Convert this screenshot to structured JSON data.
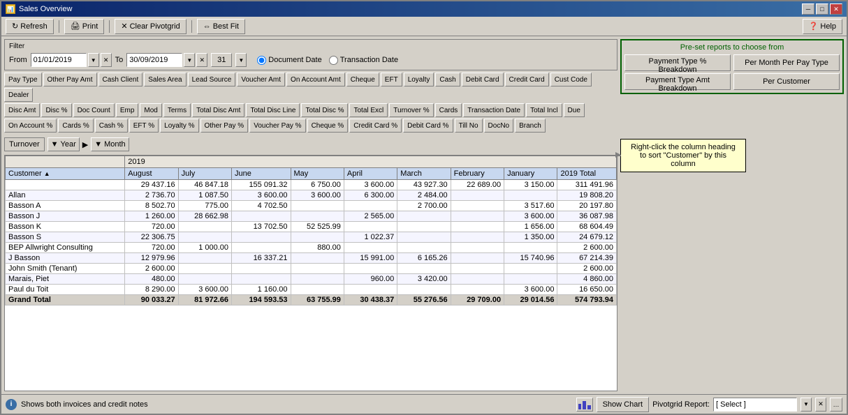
{
  "window": {
    "title": "Sales Overview"
  },
  "toolbar": {
    "refresh": "Refresh",
    "print": "Print",
    "clear_pivotgrid": "Clear Pivotgrid",
    "best_fit": "Best Fit",
    "help": "Help"
  },
  "filter": {
    "label": "Filter",
    "from_label": "From",
    "to_label": "To",
    "from_date": "01/01/2019",
    "to_date": "30/09/2019",
    "num": "31",
    "document_date": "Document Date",
    "transaction_date": "Transaction Date"
  },
  "preset": {
    "label": "Pre-set reports to choose from",
    "buttons": [
      [
        "Payment Type % Breakdown",
        "Per Month Per Pay Type"
      ],
      [
        "Payment Type Amt Breakdown",
        "Per Customer"
      ]
    ]
  },
  "field_rows": {
    "row1": [
      "Pay Type",
      "Other Pay Amt",
      "Cash Client",
      "Sales Area",
      "Lead Source",
      "Voucher Amt",
      "On Account Amt",
      "Cheque",
      "EFT",
      "Loyalty",
      "Cash",
      "Debit Card",
      "Credit Card",
      "Cust Code",
      "Dealer"
    ],
    "row2": [
      "Disc Amt",
      "Disc %",
      "Doc Count",
      "Emp",
      "Mod",
      "Terms",
      "Total Disc Amt",
      "Total Disc Line",
      "Total Disc %",
      "Total Excl",
      "Turnover %",
      "Cards",
      "Transaction Date",
      "Total Incl",
      "Due"
    ],
    "row3": [
      "On Account %",
      "Cards %",
      "Cash %",
      "EFT %",
      "Loyalty %",
      "Other Pay %",
      "Voucher Pay %",
      "Cheque %",
      "Credit Card %",
      "Debit Card %",
      "Till No",
      "DocNo",
      "Branch"
    ]
  },
  "pivot": {
    "row_label": "Turnover",
    "col1_label": "Year",
    "col2_label": "Month"
  },
  "table": {
    "year": "2019",
    "customer_header": "Customer",
    "columns": [
      "August",
      "July",
      "June",
      "May",
      "April",
      "March",
      "February",
      "January",
      "2019 Total"
    ],
    "rows": [
      {
        "customer": "",
        "august": "29 437.16",
        "july": "46 847.18",
        "june": "155 091.32",
        "may": "6 750.00",
        "april": "3 600.00",
        "march": "43 927.30",
        "february": "22 689.00",
        "january": "3 150.00",
        "total": "311 491.96"
      },
      {
        "customer": "Allan",
        "august": "2 736.70",
        "july": "1 087.50",
        "june": "3 600.00",
        "may": "3 600.00",
        "april": "6 300.00",
        "march": "2 484.00",
        "february": "",
        "january": "",
        "total": "19 808.20"
      },
      {
        "customer": "Basson A",
        "august": "8 502.70",
        "july": "775.00",
        "june": "4 702.50",
        "may": "",
        "april": "",
        "march": "2 700.00",
        "february": "",
        "january": "3 517.60",
        "total": "20 197.80"
      },
      {
        "customer": "Basson J",
        "august": "1 260.00",
        "july": "28 662.98",
        "june": "",
        "may": "",
        "april": "2 565.00",
        "march": "",
        "february": "",
        "january": "3 600.00",
        "total": "36 087.98"
      },
      {
        "customer": "Basson K",
        "august": "720.00",
        "july": "",
        "june": "13 702.50",
        "may": "52 525.99",
        "april": "",
        "march": "",
        "february": "",
        "january": "1 656.00",
        "total": "68 604.49"
      },
      {
        "customer": "Basson S",
        "august": "22 306.75",
        "july": "",
        "june": "",
        "may": "",
        "april": "1 022.37",
        "march": "",
        "february": "",
        "january": "1 350.00",
        "total": "24 679.12"
      },
      {
        "customer": "BEP Allwright Consulting",
        "august": "720.00",
        "july": "1 000.00",
        "june": "",
        "may": "880.00",
        "april": "",
        "march": "",
        "february": "",
        "january": "",
        "total": "2 600.00"
      },
      {
        "customer": "J Basson",
        "august": "12 979.96",
        "july": "",
        "june": "16 337.21",
        "may": "",
        "april": "15 991.00",
        "march": "6 165.26",
        "february": "",
        "january": "15 740.96",
        "total": "67 214.39"
      },
      {
        "customer": "John Smith (Tenant)",
        "august": "2 600.00",
        "july": "",
        "june": "",
        "may": "",
        "april": "",
        "march": "",
        "february": "",
        "january": "",
        "total": "2 600.00"
      },
      {
        "customer": "Marais, Piet",
        "august": "480.00",
        "july": "",
        "june": "",
        "may": "",
        "april": "960.00",
        "march": "3 420.00",
        "february": "",
        "january": "",
        "total": "4 860.00"
      },
      {
        "customer": "Paul du Toit",
        "august": "8 290.00",
        "july": "3 600.00",
        "june": "1 160.00",
        "may": "",
        "april": "",
        "march": "",
        "february": "",
        "january": "3 600.00",
        "total": "16 650.00"
      }
    ],
    "grand_total": {
      "label": "Grand Total",
      "august": "90 033.27",
      "july": "81 972.66",
      "june": "194 593.53",
      "may": "63 755.99",
      "april": "30 438.37",
      "march": "55 276.56",
      "february": "29 709.00",
      "january": "29 014.56",
      "total": "574 793.94"
    }
  },
  "status": {
    "info_text": "Shows both invoices and credit notes",
    "show_chart": "Show Chart",
    "report_label": "Pivotgrid Report:",
    "report_select": "[ Select ]"
  },
  "tooltip": {
    "text": "Right-click the column heading to sort \"Customer\" by this column"
  }
}
